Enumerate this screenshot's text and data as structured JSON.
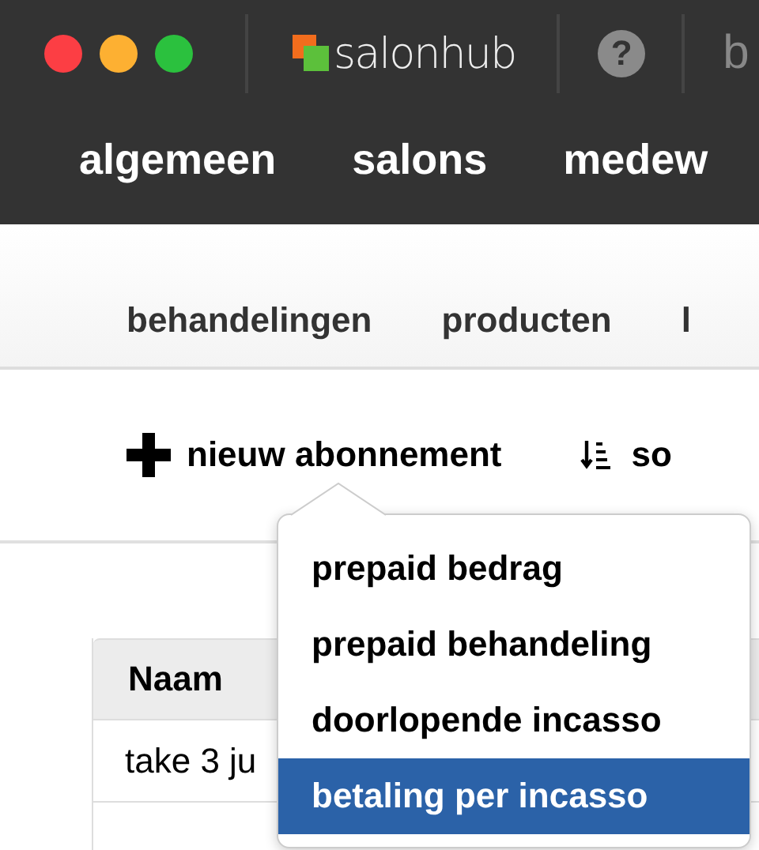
{
  "top_bar": {
    "logo": "salonhub",
    "help": "?",
    "cut_text": "b"
  },
  "nav": [
    {
      "label": "algemeen"
    },
    {
      "label": "salons"
    },
    {
      "label": "medew"
    }
  ],
  "subnav": [
    {
      "label": "behandelingen"
    },
    {
      "label": "producten"
    },
    {
      "label": "l"
    }
  ],
  "toolbar": {
    "new_button": "nieuw abonnement",
    "sort_button": "so"
  },
  "dropdown": [
    {
      "label": "prepaid bedrag",
      "selected": false
    },
    {
      "label": "prepaid behandeling",
      "selected": false
    },
    {
      "label": "doorlopende incasso",
      "selected": false
    },
    {
      "label": "betaling per incasso",
      "selected": true
    }
  ],
  "table": {
    "columns": [
      "Naam"
    ],
    "rows": [
      "take 3 ju"
    ]
  }
}
